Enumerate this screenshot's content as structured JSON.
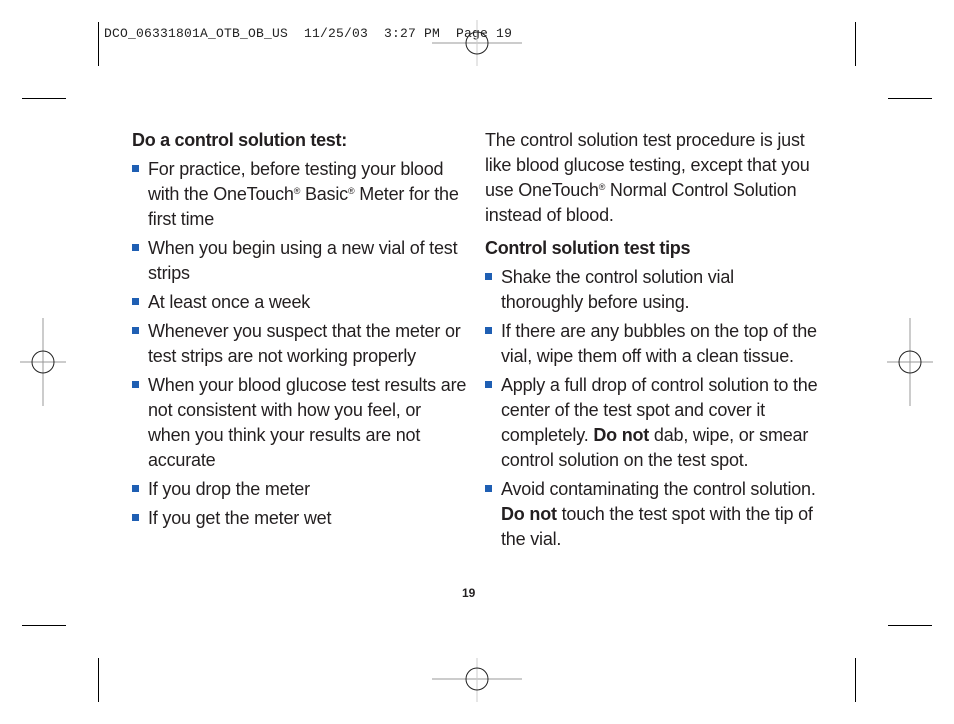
{
  "slug_line": "DCO_06331801A_OTB_OB_US  11/25/03  3:27 PM  Page 19",
  "left_column": {
    "heading": "Do a control solution test:",
    "bullets": [
      {
        "parts": [
          "For practice, before testing your blood with the OneTouch",
          "®",
          " Basic",
          "®",
          " Meter for the first time"
        ]
      },
      {
        "text": "When you begin using a new vial of test strips"
      },
      {
        "text": "At least once a week"
      },
      {
        "text": "Whenever you suspect that the meter or test strips are not working properly"
      },
      {
        "text": "When your blood glucose test results are not consistent with how you feel, or when you think your results are not accurate"
      },
      {
        "text": "If you drop the meter"
      },
      {
        "text": "If you get the meter wet"
      }
    ]
  },
  "right_column": {
    "intro_parts": [
      "The control solution test procedure is just like blood glucose testing, except that you use OneTouch",
      "®",
      " Normal Control Solution instead of blood."
    ],
    "heading": "Control solution test tips",
    "bullets": [
      {
        "before": "Shake the control solution vial thoroughly before using.",
        "bold": "",
        "after": ""
      },
      {
        "before": "If there are any bubbles on the top of the vial, wipe them off with a clean tissue.",
        "bold": "",
        "after": ""
      },
      {
        "before": "Apply a full drop of control solution to the center of the test spot and cover it completely. ",
        "bold": "Do not",
        "after": " dab, wipe, or smear control solution on the test spot."
      },
      {
        "before": "Avoid contaminating the control solution. ",
        "bold": "Do not",
        "after": " touch the test spot with the tip of the vial."
      }
    ]
  },
  "page_number": "19",
  "colors": {
    "bullet": "#1f5fb3",
    "text": "#231f20"
  }
}
